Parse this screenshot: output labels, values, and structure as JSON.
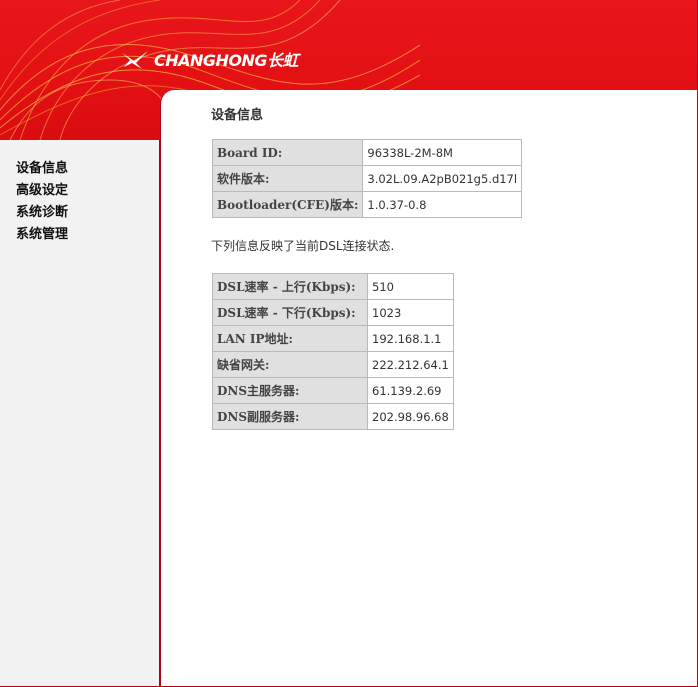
{
  "brand": {
    "logo_text": "CHANGHONG长虹",
    "color": "#e31013"
  },
  "sidebar": {
    "items": [
      {
        "label": "设备信息"
      },
      {
        "label": "高级设定"
      },
      {
        "label": "系统诊断"
      },
      {
        "label": "系统管理"
      }
    ]
  },
  "main": {
    "title": "设备信息",
    "device_table": [
      {
        "key": "Board ID:",
        "value": "96338L-2M-8M"
      },
      {
        "key": "软件版本:",
        "value": "3.02L.09.A2pB021g5.d17l"
      },
      {
        "key": "Bootloader(CFE)版本:",
        "value": "1.0.37-0.8"
      }
    ],
    "description": "下列信息反映了当前DSL连接状态.",
    "dsl_table": [
      {
        "key": "DSL速率 - 上行(Kbps):",
        "value": "510"
      },
      {
        "key": "DSL速率 - 下行(Kbps):",
        "value": "1023"
      },
      {
        "key": "LAN IP地址:",
        "value": "192.168.1.1"
      },
      {
        "key": "缺省网关:",
        "value": "222.212.64.1"
      },
      {
        "key": "DNS主服务器:",
        "value": "61.139.2.69"
      },
      {
        "key": "DNS副服务器:",
        "value": "202.98.96.68"
      }
    ]
  }
}
